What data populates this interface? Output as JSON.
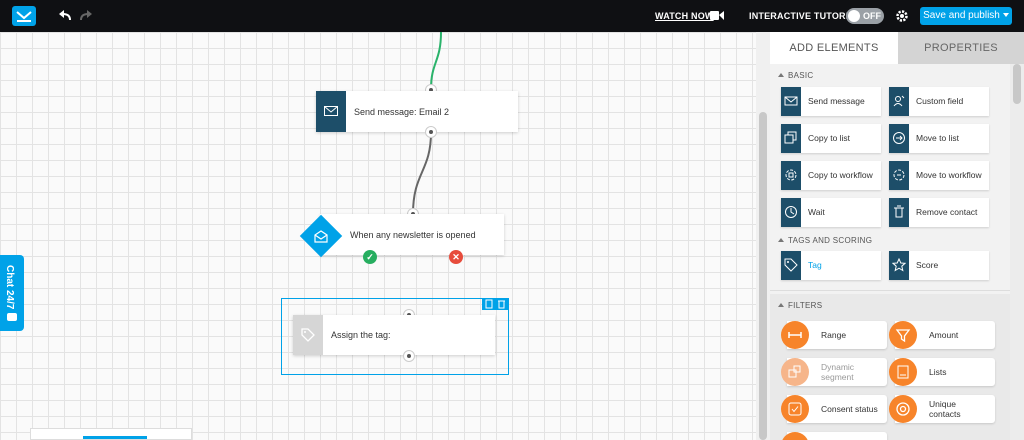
{
  "topbar": {
    "watch_now": "WATCH NOW",
    "interactive_tutorial": "INTERACTIVE TUTORIAL",
    "tutorial_toggle": "OFF",
    "save_publish": "Save and publish"
  },
  "canvas": {
    "nodes": {
      "send_message": "Send message: Email 2",
      "condition": "When any newsletter is opened",
      "assign_tag": "Assign the tag:"
    },
    "chat": "Chat 24/7"
  },
  "panel": {
    "tabs": {
      "add": "ADD ELEMENTS",
      "properties": "PROPERTIES"
    },
    "sections": {
      "basic": "BASIC",
      "tags": "TAGS AND SCORING",
      "filters": "FILTERS"
    },
    "basic": [
      {
        "label": "Send message",
        "icon": "envelope-icon"
      },
      {
        "label": "Custom field",
        "icon": "person-edit-icon"
      },
      {
        "label": "Copy to list",
        "icon": "copy-icon"
      },
      {
        "label": "Move to list",
        "icon": "arrow-circle-icon"
      },
      {
        "label": "Copy to workflow",
        "icon": "copy-workflow-icon"
      },
      {
        "label": "Move to workflow",
        "icon": "move-workflow-icon"
      },
      {
        "label": "Wait",
        "icon": "clock-icon"
      },
      {
        "label": "Remove contact",
        "icon": "trash-icon"
      }
    ],
    "tags": [
      {
        "label": "Tag",
        "icon": "tag-icon"
      },
      {
        "label": "Score",
        "icon": "star-icon"
      }
    ],
    "filters": [
      {
        "label": "Range",
        "icon": "range-icon"
      },
      {
        "label": "Amount",
        "icon": "funnel-icon"
      },
      {
        "label": "Dynamic segment",
        "line1": "Dynamic",
        "line2": "segment",
        "icon": "segment-icon"
      },
      {
        "label": "Lists",
        "icon": "list-icon"
      },
      {
        "label": "Consent status",
        "icon": "check-square-icon"
      },
      {
        "label": "Unique contacts",
        "line1": "Unique",
        "line2": "contacts",
        "icon": "at-icon"
      }
    ]
  },
  "colors": {
    "accent": "#00a2e8",
    "node_icon": "#1d4e69",
    "filter_orange": "#f7842a",
    "success": "#27ae60",
    "error": "#e74c3c",
    "topbar": "#0f1013"
  }
}
